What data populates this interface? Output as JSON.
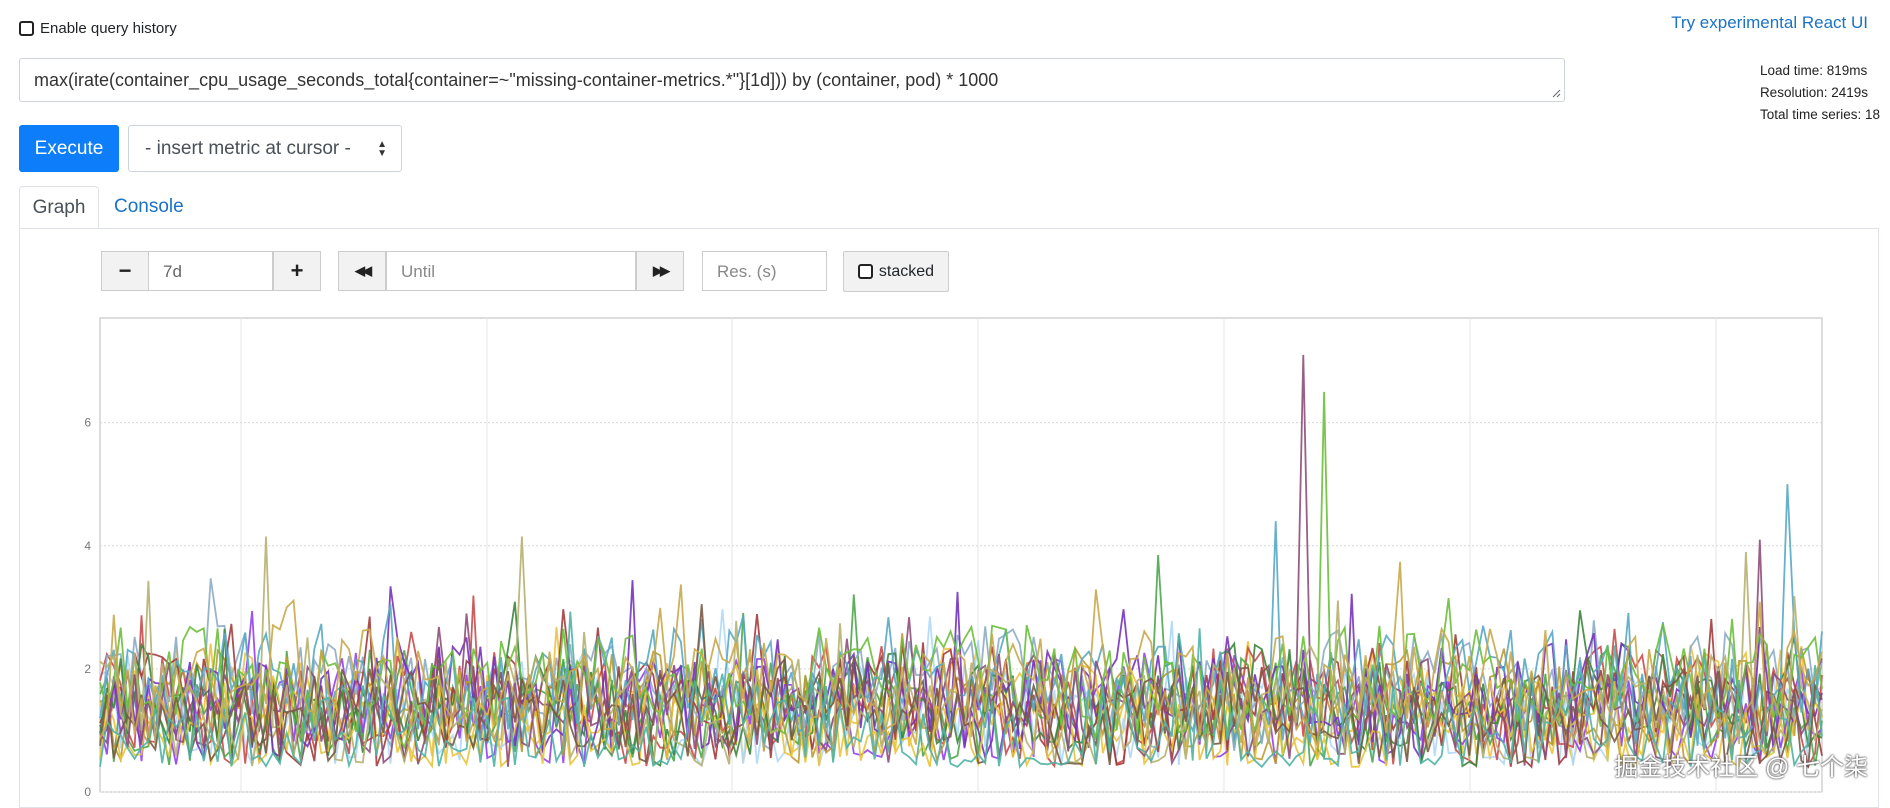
{
  "header": {
    "query_history_label": "Enable query history",
    "react_link": "Try experimental React UI"
  },
  "stats": {
    "load_time": "Load time: 819ms",
    "resolution": "Resolution: 2419s",
    "total_series": "Total time series: 18"
  },
  "query": {
    "expression": "max(irate(container_cpu_usage_seconds_total{container=~\"missing-container-metrics.*\"}[1d])) by (container, pod) * 1000"
  },
  "toolbar": {
    "execute_label": "Execute",
    "metric_select": "- insert metric at cursor -"
  },
  "tabs": {
    "graph": "Graph",
    "console": "Console"
  },
  "graph_controls": {
    "decrease": "−",
    "range": "7d",
    "increase": "+",
    "back": "◀◀",
    "until_placeholder": "Until",
    "forward": "▶▶",
    "res_placeholder": "Res. (s)",
    "stacked_label": "stacked"
  },
  "chart_data": {
    "type": "line",
    "ylim": [
      0,
      7.7
    ],
    "yticks": [
      "0",
      "2",
      "4",
      "6"
    ],
    "num_series": 18,
    "points_per_series": 250,
    "grid": true,
    "colors": [
      "#edc240",
      "#afd8f8",
      "#cb4b4b",
      "#4da74d",
      "#9440ed",
      "#bd9b33",
      "#8cacc6",
      "#a23c3c",
      "#3d853d",
      "#7633bd",
      "#e8c43a",
      "#56a8c4",
      "#8e4e7a",
      "#6bbf3a",
      "#b5b070",
      "#7a5a46",
      "#4fb3a5",
      "#c9a84b"
    ],
    "series": [],
    "peaks": [
      {
        "series": 12,
        "index": 174,
        "value": 7.1
      },
      {
        "series": 13,
        "index": 177,
        "value": 6.5
      },
      {
        "series": 11,
        "index": 170,
        "value": 4.4
      },
      {
        "series": 11,
        "index": 244,
        "value": 5.0
      },
      {
        "series": 14,
        "index": 238,
        "value": 3.9
      },
      {
        "series": 12,
        "index": 240,
        "value": 4.1
      },
      {
        "series": 14,
        "index": 24,
        "value": 4.15
      },
      {
        "series": 14,
        "index": 61,
        "value": 4.15
      }
    ]
  },
  "watermark": "掘金技术社区 @ 七个柒"
}
